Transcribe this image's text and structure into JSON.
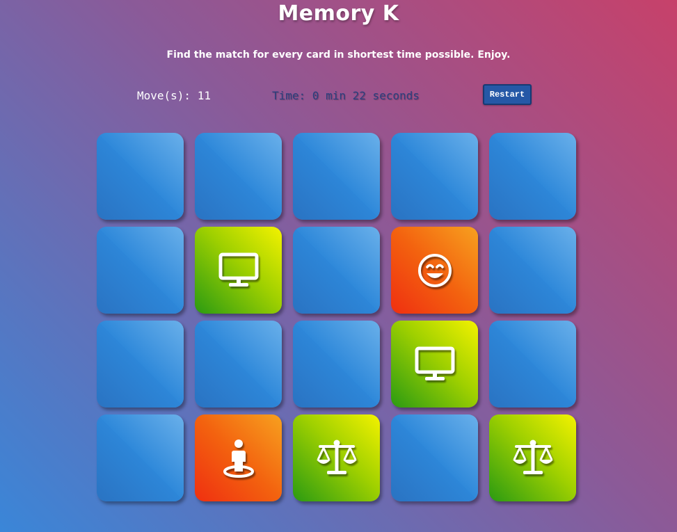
{
  "header": {
    "title": "Memory K",
    "subtitle": "Find the match for every card in shortest time possible. Enjoy."
  },
  "stats": {
    "moves": "Move(s): 11",
    "timer": "Time: 0 min 22 seconds",
    "restart_label": "Restart"
  },
  "colors": {
    "card_back": "#2d86d8",
    "card_green": "#9fd000",
    "card_orange": "#f3620f",
    "timer_text": "#2b3f7e",
    "restart_bg": "#2558a6"
  },
  "cards": [
    {
      "state": "hidden"
    },
    {
      "state": "hidden"
    },
    {
      "state": "hidden"
    },
    {
      "state": "hidden"
    },
    {
      "state": "hidden"
    },
    {
      "state": "hidden"
    },
    {
      "state": "open",
      "icon": "desktop-icon",
      "color": "green"
    },
    {
      "state": "hidden"
    },
    {
      "state": "open",
      "icon": "smiley-icon",
      "color": "orange"
    },
    {
      "state": "hidden"
    },
    {
      "state": "hidden"
    },
    {
      "state": "hidden"
    },
    {
      "state": "hidden"
    },
    {
      "state": "open",
      "icon": "desktop-icon",
      "color": "green"
    },
    {
      "state": "hidden"
    },
    {
      "state": "hidden"
    },
    {
      "state": "open",
      "icon": "person-pin-icon",
      "color": "orange"
    },
    {
      "state": "open",
      "icon": "balance-scale-icon",
      "color": "green"
    },
    {
      "state": "hidden"
    },
    {
      "state": "open",
      "icon": "balance-scale-icon",
      "color": "green"
    }
  ]
}
